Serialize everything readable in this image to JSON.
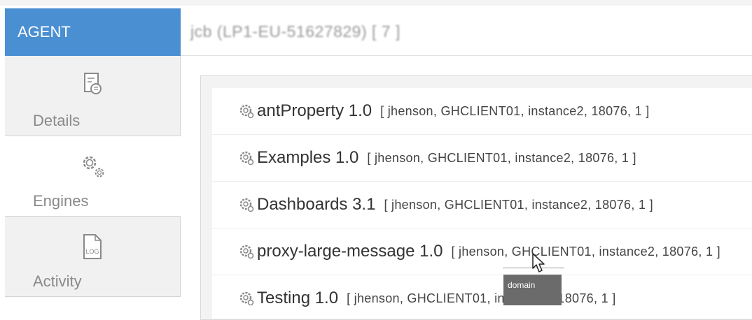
{
  "agent_tab": {
    "label": "AGENT"
  },
  "header": {
    "title": "jcb (LP1-EU-51627829) [ 7 ]"
  },
  "sidebar": {
    "items": [
      {
        "label": "Details",
        "icon": "details-doc-icon",
        "active": false
      },
      {
        "label": "Engines",
        "icon": "gears-icon",
        "active": true
      },
      {
        "label": "Activity",
        "icon": "log-file-icon",
        "active": false
      }
    ]
  },
  "engines": [
    {
      "name": "antProperty 1.0",
      "meta": "[ jhenson, GHCLIENT01, instance2, 18076, 1 ]"
    },
    {
      "name": "Examples 1.0",
      "meta": "[ jhenson, GHCLIENT01, instance2, 18076, 1 ]"
    },
    {
      "name": "Dashboards 3.1",
      "meta": "[ jhenson, GHCLIENT01, instance2, 18076, 1 ]"
    },
    {
      "name": "proxy-large-message 1.0",
      "meta": "[ jhenson, GHCLIENT01, instance2, 18076, 1 ]"
    },
    {
      "name": "Testing 1.0",
      "meta": "[ jhenson, GHCLIENT01, instance2, 18076, 1 ]"
    }
  ],
  "tooltip": {
    "text": "domain"
  },
  "log_icon_text": "LOG",
  "colors": {
    "accent": "#4a8fd1",
    "sidebar_bg": "#f1f1f1",
    "text": "#333333"
  }
}
